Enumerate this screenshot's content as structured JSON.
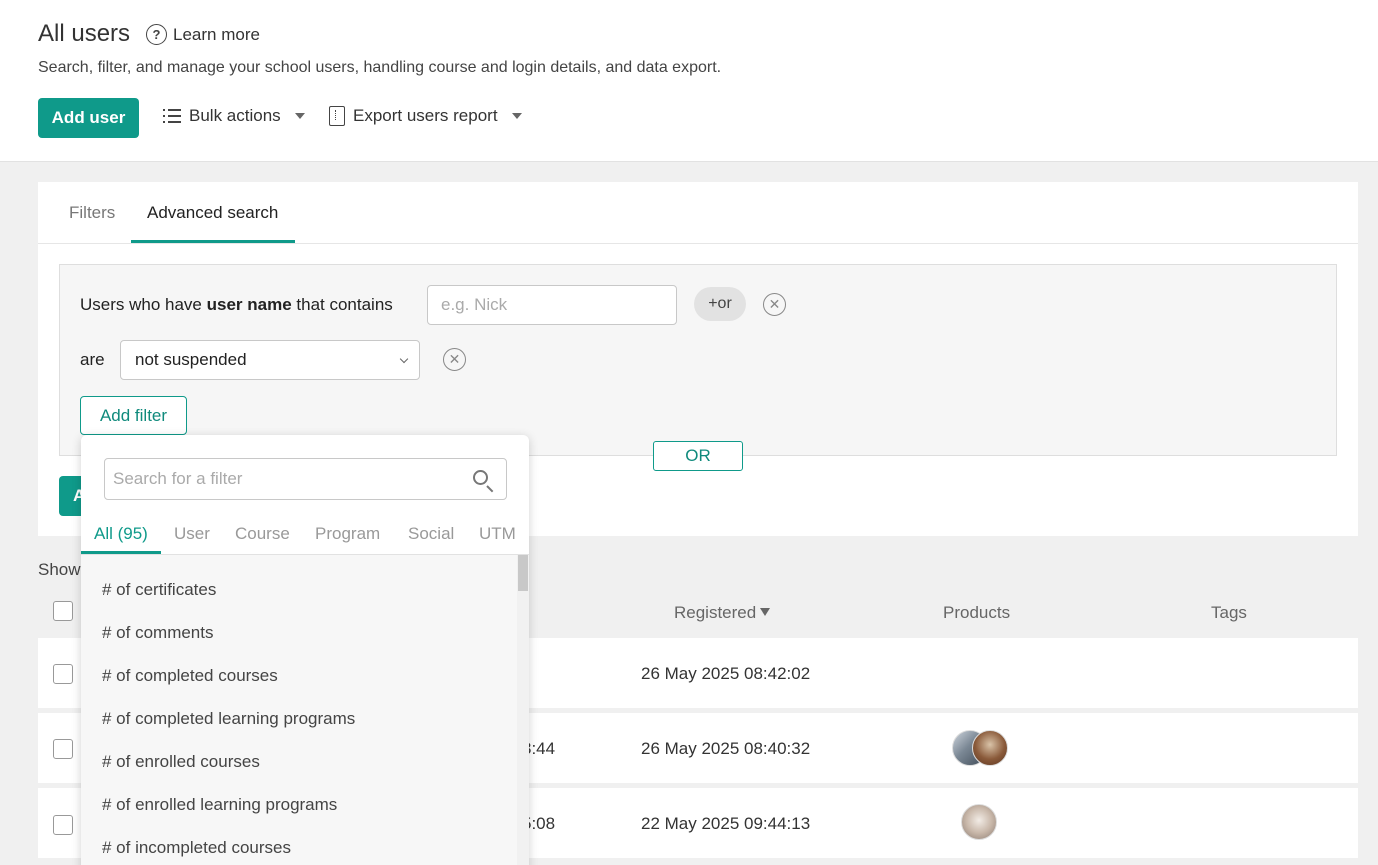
{
  "header": {
    "title": "All users",
    "learn_more": "Learn more",
    "subtitle": "Search, filter, and manage your school users, handling course and login details, and data export.",
    "add_user": "Add user",
    "bulk_actions": "Bulk actions",
    "export_report": "Export users report"
  },
  "tabs": {
    "filters": "Filters",
    "advanced_search": "Advanced search"
  },
  "criteria": {
    "row1_prefix": "Users who have ",
    "row1_field": "user name",
    "row1_suffix": " that contains",
    "row1_placeholder": "e.g. Nick",
    "or_pill": "+or",
    "row2_label": "are",
    "row2_value": "not suspended",
    "add_filter": "Add filter",
    "or_button": "OR",
    "apply_partial": "A"
  },
  "table": {
    "show_partial": "Show",
    "columns": {
      "registered": "Registered",
      "products": "Products",
      "tags": "Tags"
    },
    "rows": [
      {
        "partial": "",
        "registered": "26 May 2025 08:42:02"
      },
      {
        "partial": "3:44",
        "registered": "26 May 2025 08:40:32"
      },
      {
        "partial": "5:08",
        "registered": "22 May 2025 09:44:13"
      }
    ]
  },
  "dropdown": {
    "search_placeholder": "Search for a filter",
    "tabs": [
      "All (95)",
      "User",
      "Course",
      "Program",
      "Social",
      "UTM"
    ],
    "items": [
      "# of certificates",
      "# of comments",
      "# of completed courses",
      "# of completed learning programs",
      "# of enrolled courses",
      "# of enrolled learning programs",
      "# of incompleted courses"
    ]
  },
  "colors": {
    "accent": "#0f9a8a",
    "background": "#f0f0f0"
  }
}
